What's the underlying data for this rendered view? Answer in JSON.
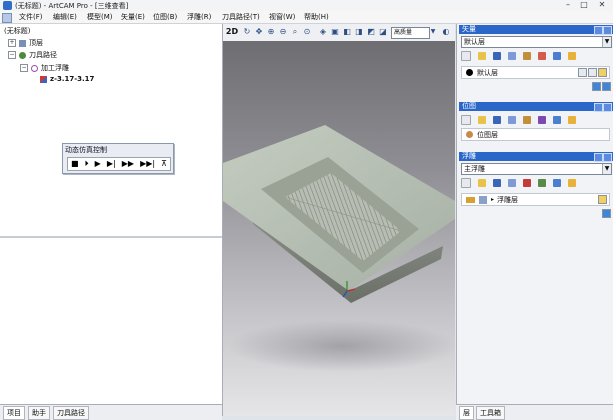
{
  "window": {
    "title": "(无标题) - ArtCAM Pro - [三维查看]",
    "min_glyph": "–",
    "max_glyph": "□",
    "close_glyph": "✕"
  },
  "menu": [
    "文件(F)",
    "编辑(E)",
    "模型(M)",
    "矢量(E)",
    "位图(B)",
    "浮雕(R)",
    "刀具路径(T)",
    "视窗(W)",
    "帮助(H)"
  ],
  "tree": {
    "root": "(无标题)",
    "top": "顶层",
    "toolpaths": "刀具路径",
    "roughing": "加工浮雕",
    "detail": "z-3.17-3.17"
  },
  "sim_dialog": {
    "title": "动态仿真控制",
    "controls": [
      "■",
      "⏵",
      "▶",
      "▶|",
      "▶▶",
      "▶▶|",
      "⊼"
    ]
  },
  "left_tabs": [
    "项目",
    "助手",
    "刀具路径"
  ],
  "view_toolbar": {
    "mode_label": "2D",
    "select_value": "高质量"
  },
  "right": {
    "vector_section": "矢量",
    "vector_combo": "默认层",
    "vector_layer": "默认层",
    "bitmap_section": "位图",
    "bitmap_layer": "位图层",
    "relief_section": "浮雕",
    "relief_combo": "主浮雕",
    "relief_layer": "浮雕层",
    "tabs": [
      "层",
      "工具箱"
    ]
  },
  "colors": {
    "section_header": "#2a67c9",
    "accent": "#3f86d8"
  }
}
